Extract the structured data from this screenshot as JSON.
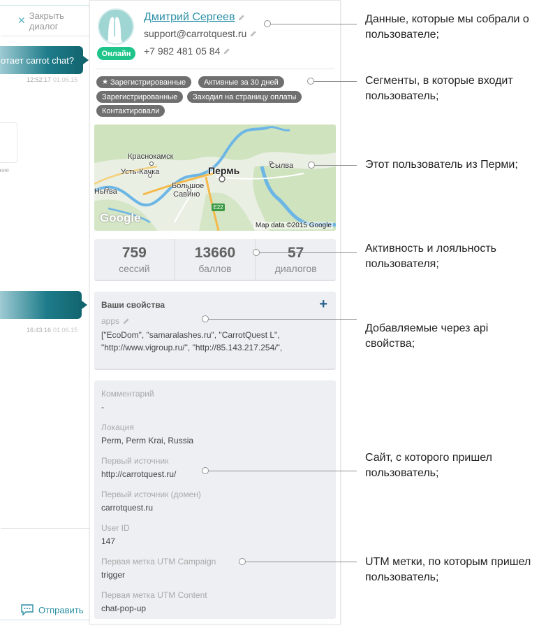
{
  "chat": {
    "close_dialog_label": "Закрыть диалог",
    "message_1": "отает carrot chat?",
    "message_1_time": "12:52:17",
    "message_1_date": "01.06.15",
    "attachment_caption": "вание",
    "message_2_time": "16:43:16",
    "message_2_date": "01.06.15",
    "send_label": "Отправить"
  },
  "user": {
    "name": "Дмитрий Сергеев",
    "email": "support@carrotquest.ru",
    "phone": "+7 982 481 05 84",
    "status": "Онлайн"
  },
  "segments": [
    {
      "label": "Зарегистрированные",
      "starred": true
    },
    {
      "label": "Активные за 30 дней",
      "starred": false
    },
    {
      "label": "Зарегистрированные",
      "starred": false
    },
    {
      "label": "Заходил на страницу оплаты",
      "starred": false
    },
    {
      "label": "Контактировали",
      "starred": false
    }
  ],
  "map": {
    "labels": {
      "krasnokamsk": "Краснокамск",
      "ust_kachka": "Усть-Качка",
      "perm": "Пермь",
      "bolshoe_savino_1": "Большое",
      "bolshoe_savino_2": "Савино",
      "nytva": "Нытва",
      "sylva": "Сылва"
    },
    "road": "E22",
    "google": "Google",
    "attribution": "Map data ©2015 Google"
  },
  "stats": [
    {
      "value": "759",
      "label": "сессий"
    },
    {
      "value": "13660",
      "label": "баллов"
    },
    {
      "value": "57",
      "label": "диалогов"
    }
  ],
  "custom_props": {
    "title": "Ваши свойства",
    "add_label": "+",
    "apps_label": "apps",
    "apps_value": "[\"EcoDom\", \"samaralashes.ru\", \"CarrotQuest L\", \"http://www.vigroup.ru/\", \"http://85.143.217.254/\","
  },
  "props": [
    {
      "label": "Комментарий",
      "value": "-"
    },
    {
      "label": "Локация",
      "value": "Perm, Perm Krai, Russia"
    },
    {
      "label": "Первый источник",
      "value": "http://carrotquest.ru/"
    },
    {
      "label": "Первый источник (домен)",
      "value": "carrotquest.ru"
    },
    {
      "label": "User ID",
      "value": "147"
    },
    {
      "label": "Первая метка UTM Campaign",
      "value": "trigger"
    },
    {
      "label": "Первая метка UTM Content",
      "value": "chat-pop-up"
    }
  ],
  "annotations": [
    "Данные, которые мы собрали о пользователе;",
    "Сегменты, в которые входит пользователь;",
    "Этот пользователь из Перми;",
    "Активность и лояльность пользователя;",
    "Добавляемые через api свойства;",
    "Сайт, с которого пришел пользователь;",
    "UTM метки, по которым пришел пользователь;"
  ],
  "colors": {
    "accent": "#2a8fa6",
    "online": "#1ec48a",
    "tag": "#6f6f6f",
    "panel": "#eeeff3"
  }
}
